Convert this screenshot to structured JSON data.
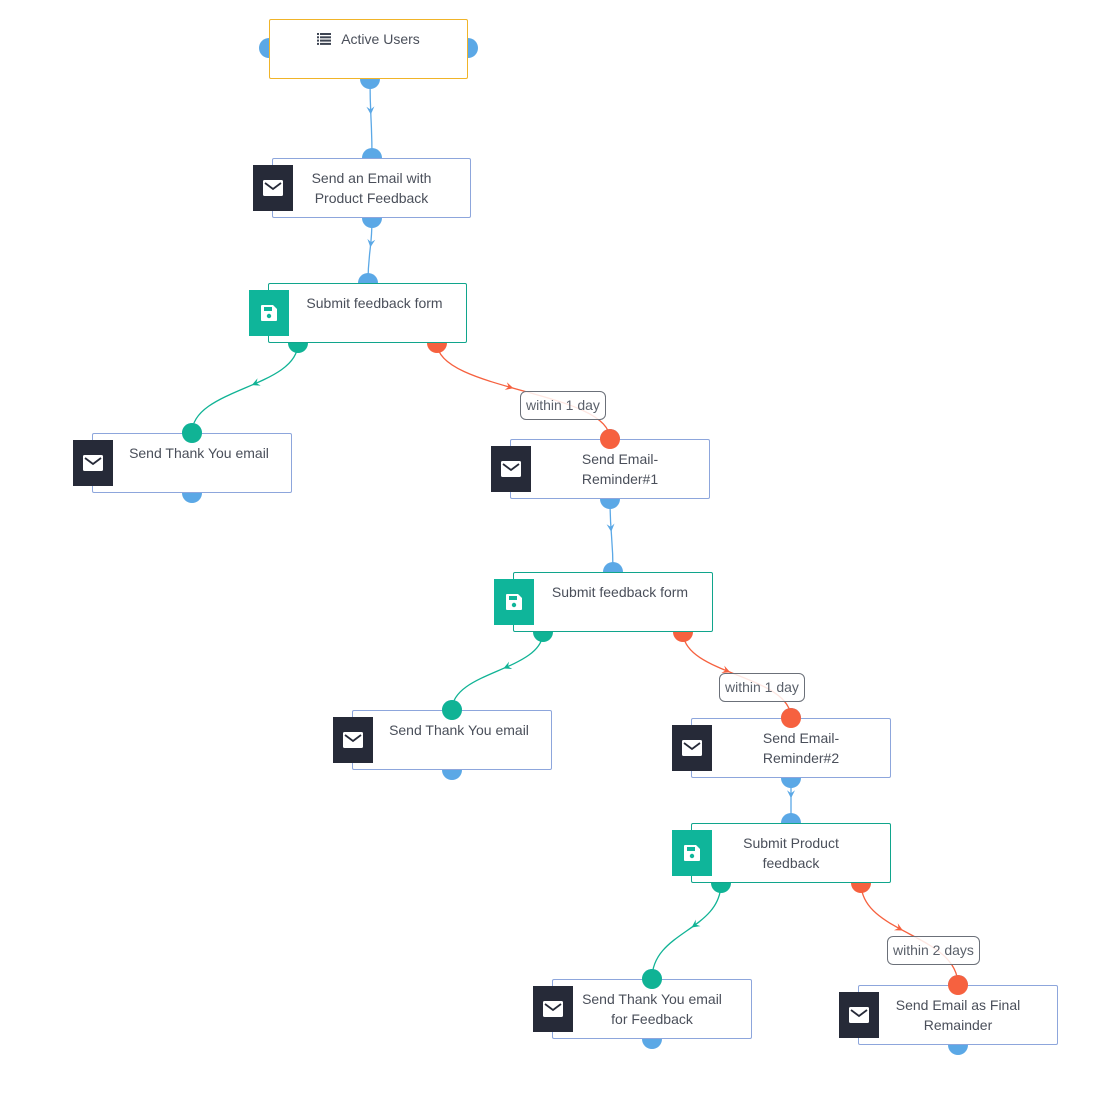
{
  "colors": {
    "start_border": "#f0b429",
    "email_border": "#8da6dc",
    "form_border": "#10a58c",
    "email_badge": "#262a38",
    "form_badge": "#0fb59a",
    "port_default": "#5ba8e6",
    "port_success": "#10b395",
    "port_failure": "#f6613f"
  },
  "nodes": [
    {
      "id": "active-users",
      "type": "start",
      "icon": "list-icon",
      "label": "Active Users"
    },
    {
      "id": "send-email-feedback",
      "type": "email",
      "icon": "envelope-icon",
      "label": "Send an Email with Product Feedback"
    },
    {
      "id": "submit-form-1",
      "type": "form",
      "icon": "floppy-disk-icon",
      "label": "Submit feedback form"
    },
    {
      "id": "thank-you-1",
      "type": "email",
      "icon": "envelope-icon",
      "label": "Send Thank You email"
    },
    {
      "id": "reminder-1",
      "type": "email",
      "icon": "envelope-icon",
      "label": "Send Email-Reminder#1"
    },
    {
      "id": "submit-form-2",
      "type": "form",
      "icon": "floppy-disk-icon",
      "label": "Submit feedback form"
    },
    {
      "id": "thank-you-2",
      "type": "email",
      "icon": "envelope-icon",
      "label": "Send Thank You email"
    },
    {
      "id": "reminder-2",
      "type": "email",
      "icon": "envelope-icon",
      "label": "Send Email-Reminder#2"
    },
    {
      "id": "submit-product-feedback",
      "type": "form",
      "icon": "floppy-disk-icon",
      "label": "Submit Product feedback"
    },
    {
      "id": "thank-you-feedback",
      "type": "email",
      "icon": "envelope-icon",
      "label": "Send Thank You email for Feedback"
    },
    {
      "id": "final-reminder",
      "type": "email",
      "icon": "envelope-icon",
      "label": "Send Email as Final Remainder"
    }
  ],
  "edges": [
    {
      "from": "active-users",
      "to": "send-email-feedback",
      "kind": "default"
    },
    {
      "from": "send-email-feedback",
      "to": "submit-form-1",
      "kind": "default"
    },
    {
      "from": "submit-form-1",
      "to": "thank-you-1",
      "kind": "success"
    },
    {
      "from": "submit-form-1",
      "to": "reminder-1",
      "kind": "failure",
      "condition": "within 1 day"
    },
    {
      "from": "reminder-1",
      "to": "submit-form-2",
      "kind": "default"
    },
    {
      "from": "submit-form-2",
      "to": "thank-you-2",
      "kind": "success"
    },
    {
      "from": "submit-form-2",
      "to": "reminder-2",
      "kind": "failure",
      "condition": "within 1 day"
    },
    {
      "from": "reminder-2",
      "to": "submit-product-feedback",
      "kind": "default"
    },
    {
      "from": "submit-product-feedback",
      "to": "thank-you-feedback",
      "kind": "success"
    },
    {
      "from": "submit-product-feedback",
      "to": "final-reminder",
      "kind": "failure",
      "condition": "within 2 days"
    }
  ]
}
